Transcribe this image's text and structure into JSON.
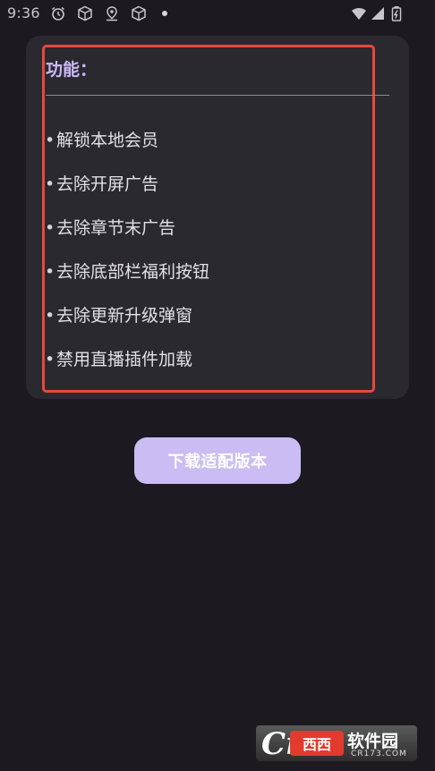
{
  "status_bar": {
    "time": "9:36",
    "left_icons": [
      "alarm-icon",
      "cube-icon",
      "location-icon",
      "cube-icon"
    ],
    "right_icons": [
      "wifi-icon",
      "signal-icon",
      "battery-icon"
    ]
  },
  "feature_card": {
    "title": "功能：",
    "items": [
      "解锁本地会员",
      "去除开屏广告",
      "去除章节末广告",
      "去除底部栏福利按钮",
      "去除更新升级弹窗",
      "禁用直播插件加载"
    ],
    "bullet": "•",
    "highlight_color": "#e8483c",
    "title_color": "#cdb8f5"
  },
  "download_button": {
    "label": "下载适配版本",
    "color": "#cbbcf4"
  },
  "watermark": {
    "logo_letter": "Cr",
    "logo_badge": "西西",
    "name": "软件园",
    "domain": "CR173.COM"
  },
  "colors": {
    "background": "#1c1a20",
    "card": "#2b2930"
  }
}
